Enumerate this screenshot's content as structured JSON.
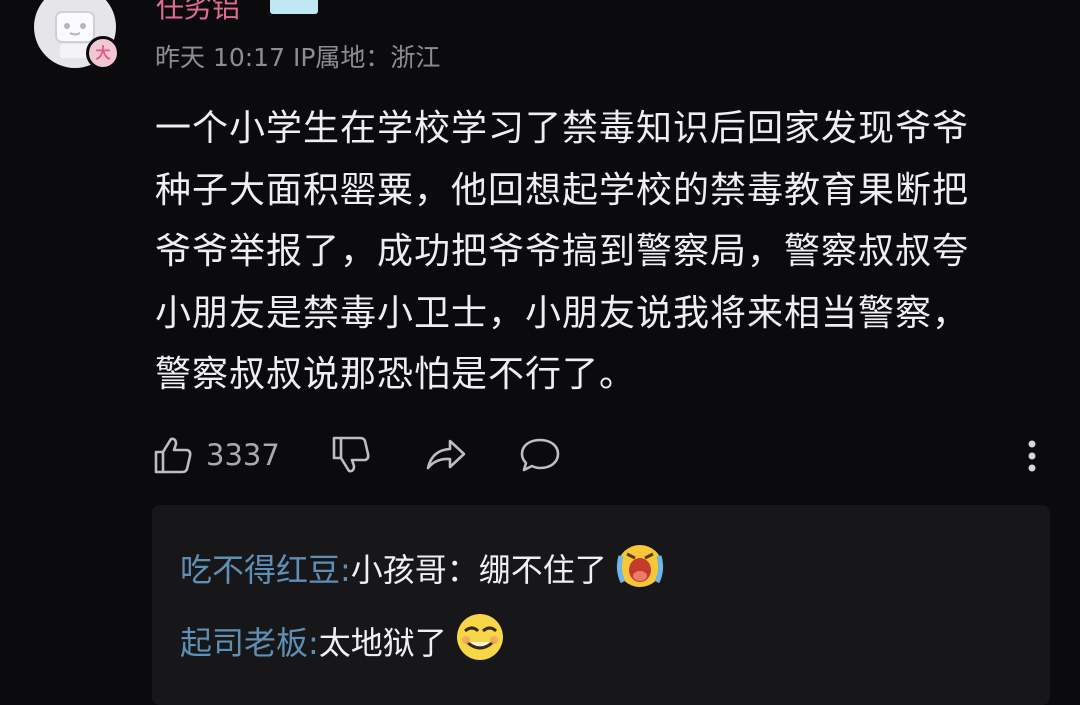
{
  "comment": {
    "username": "任劣铝",
    "level_badge": "大",
    "meta": "昨天 10:17 IP属地：浙江",
    "body_lines": [
      "一个小学生在学校学习了禁毒知识后回家发现爷爷",
      "种子大面积罂粟，他回想起学校的禁毒教育果断把",
      "爷爷举报了，成功把爷爷搞到警察局，警察叔叔夸",
      "小朋友是禁毒小卫士，小朋友说我将来相当警察，",
      "警察叔叔说那恐怕是不行了。"
    ],
    "like_count": "3337"
  },
  "actions": {
    "like_icon": "thumbs-up-icon",
    "dislike_icon": "thumbs-down-icon",
    "share_icon": "share-arrow-icon",
    "reply_icon": "speech-bubble-icon",
    "more_icon": "vertical-dots-icon"
  },
  "replies": [
    {
      "name": "吃不得红豆:",
      "text": " 小孩哥：绷不住了",
      "emoji": "crying-emoji"
    },
    {
      "name": "起司老板:",
      "text": " 太地狱了",
      "emoji": "smirk-emoji"
    }
  ],
  "colors": {
    "background": "#0b0b0d",
    "username": "#e26b92",
    "reply_name": "#5f8fb5",
    "meta": "#8d8d93"
  }
}
